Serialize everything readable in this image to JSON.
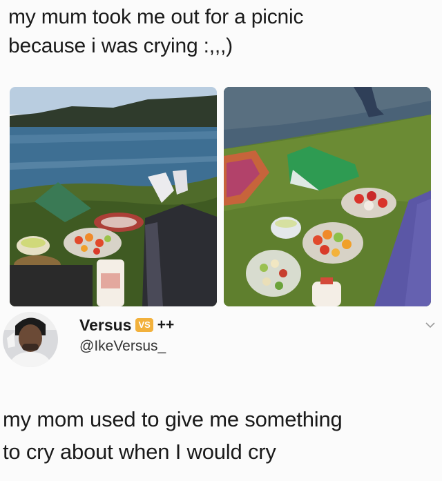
{
  "caption": {
    "line1": "my mum took me out for a picnic",
    "line2": "because i was crying :,,,)"
  },
  "photos": {
    "left": {
      "icon": "lake-picnic-photo"
    },
    "right": {
      "icon": "grass-picnic-photo"
    }
  },
  "tweet": {
    "display_name": "Versus",
    "badge": "VS",
    "suffix": "++",
    "handle": "@IkeVersus_",
    "text_line1": "my mom used to give me something",
    "text_line2": "to cry about when I would cry"
  },
  "colors": {
    "badge": "#f2b13c",
    "text": "#1a1a1a"
  }
}
